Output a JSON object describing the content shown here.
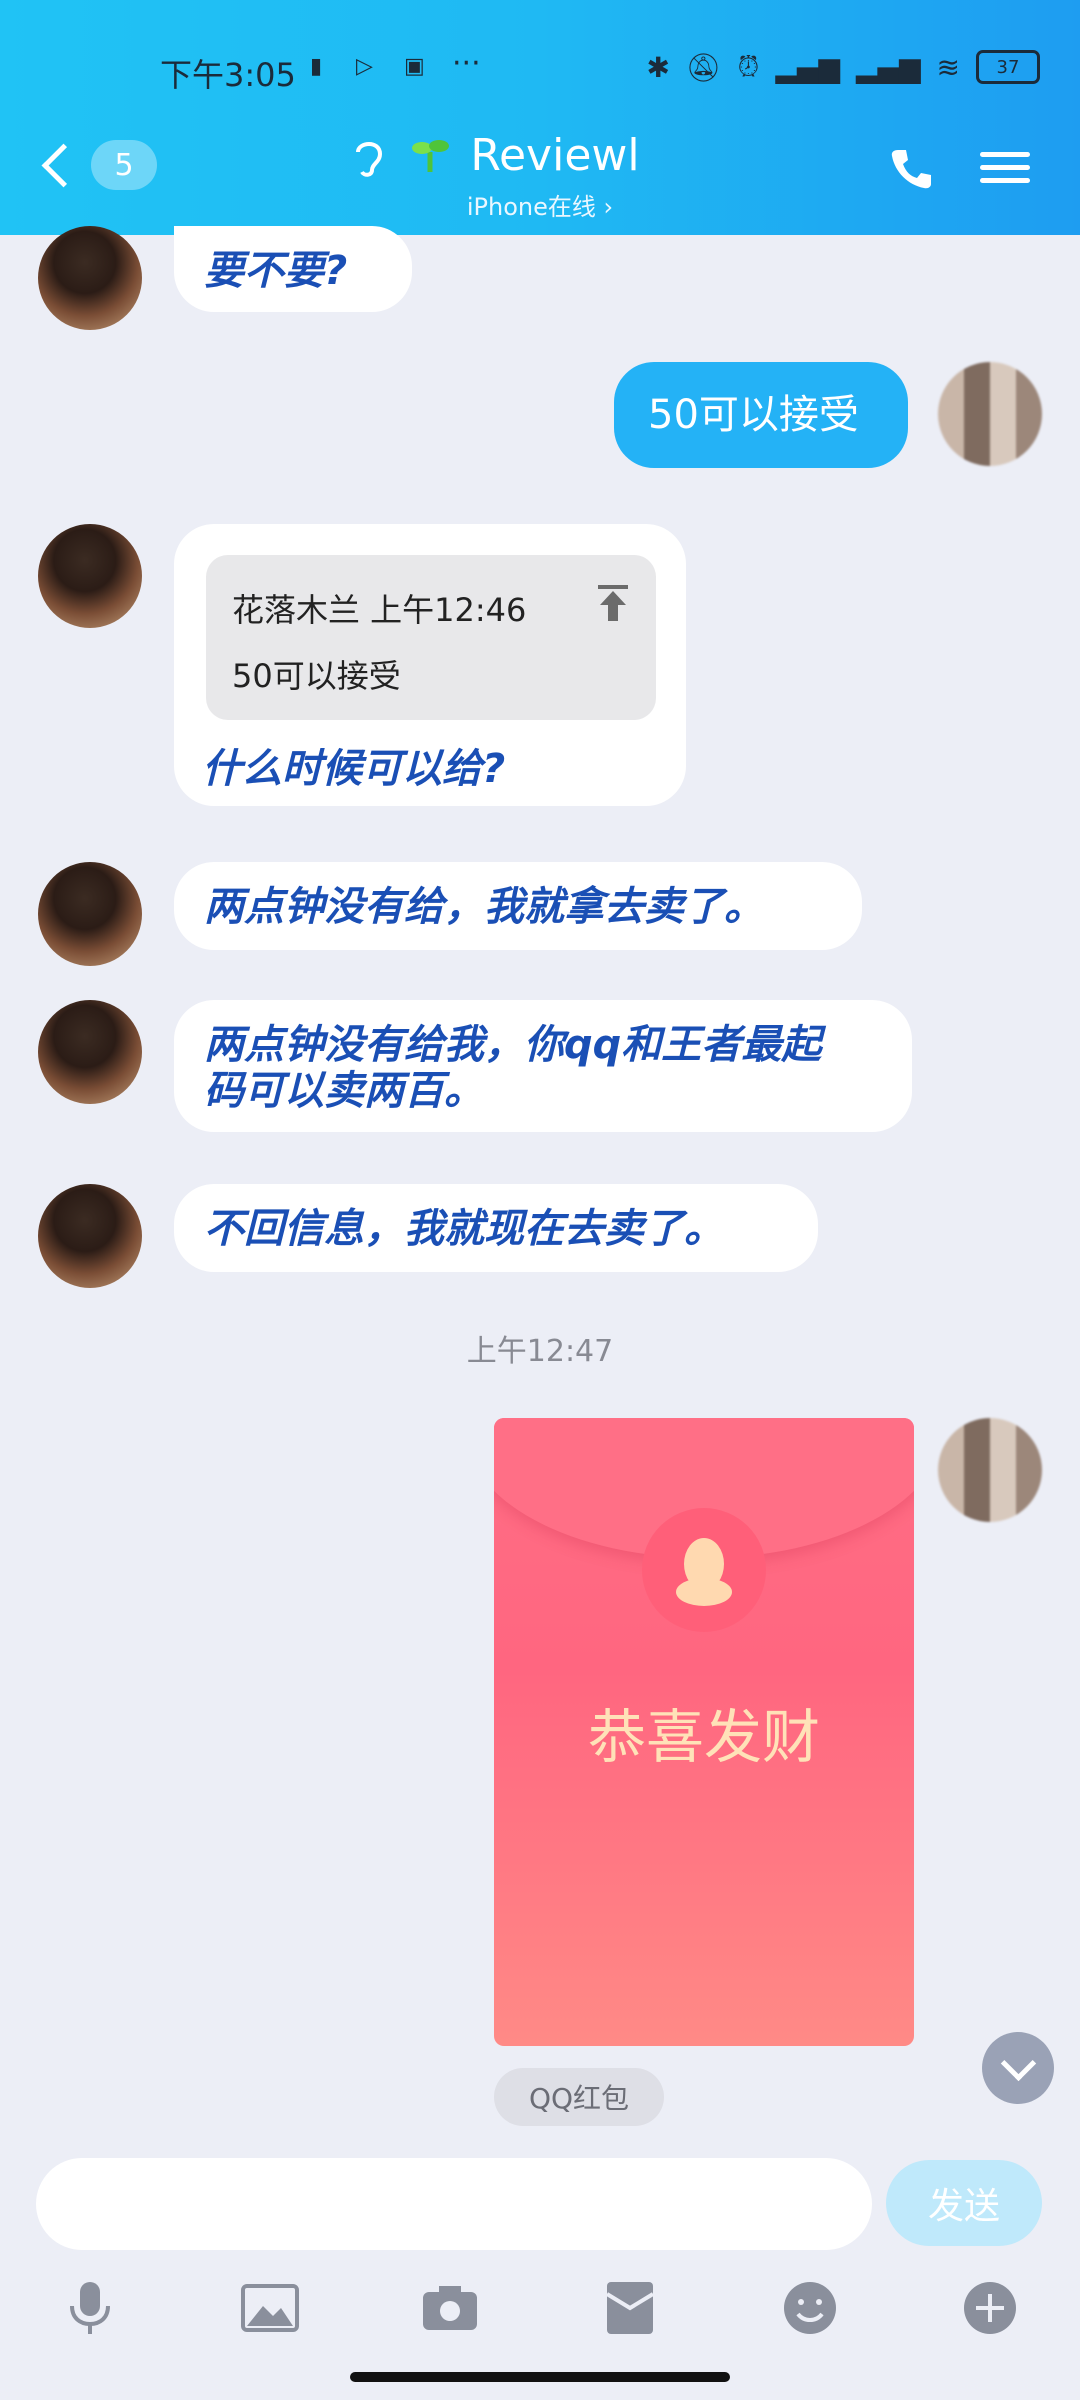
{
  "status_bar": {
    "time": "下午3:05",
    "battery": "37",
    "dots": "···"
  },
  "header": {
    "unread_count": "5",
    "contact_name": "Reviewl",
    "presence": "iPhone在线 ›"
  },
  "messages": {
    "m1": "要不要?",
    "m2_out": "50可以接受",
    "m3_quote_head": "花落木兰 上午12:46",
    "m3_quote_body": "50可以接受",
    "m3_text": "什么时候可以给?",
    "m4": "两点钟没有给，我就拿去卖了。",
    "m5_line1": "两点钟没有给我，你qq和王者最起",
    "m5_line2": "码可以卖两百。",
    "m6": "不回信息，我就现在去卖了。",
    "timestamp": "上午12:47",
    "red_packet_text": "恭喜发财",
    "red_packet_label": "QQ红包"
  },
  "input": {
    "placeholder": "",
    "send_label": "发送"
  },
  "colors": {
    "header": "#1fb9f3",
    "incoming_text": "#1a4fb5",
    "outgoing_bubble": "#24b2f6",
    "red_packet": "#ff6680"
  },
  "icons": [
    "microphone-icon",
    "image-icon",
    "camera-icon",
    "red-packet-icon",
    "emoji-icon",
    "plus-icon"
  ]
}
